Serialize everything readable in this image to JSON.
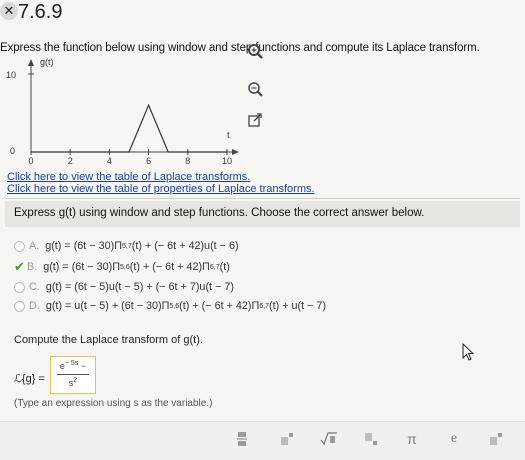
{
  "header": {
    "status_icon": "x-icon",
    "problem_number": "7.6.9"
  },
  "title": "Express the function below using window and step functions and compute its Laplace transform.",
  "graph": {
    "y_axis_label": "g(t)",
    "y_tick_label": "10",
    "x_axis_label": "t",
    "x_tick_labels": [
      "0",
      "2",
      "4",
      "6",
      "8",
      "10"
    ],
    "y_origin_label": "0"
  },
  "chart_data": {
    "type": "line",
    "x": [
      0,
      5,
      6,
      7,
      10
    ],
    "y": [
      0,
      0,
      6,
      0,
      0
    ],
    "xlim": [
      0,
      10
    ],
    "ylim": [
      0,
      10
    ],
    "xlabel": "t",
    "ylabel": "g(t)"
  },
  "links": {
    "laplace_table": "Click here to view the table of Laplace transforms.",
    "properties_table": "Click here to view the table of properties of Laplace transforms."
  },
  "question": "Express g(t) using window and step functions. Choose the correct answer below.",
  "options": [
    {
      "letter": "A.",
      "text": "g(t) = (6t − 30)Π",
      "sub": "5,7",
      "tail": "(t) + (− 6t + 42)u(t − 6)",
      "sub2": "",
      "tail2": "",
      "selected": false
    },
    {
      "letter": "B.",
      "text": "g(t) = (6t − 30)Π",
      "sub": "5,6",
      "tail": "(t) + (− 6t + 42)Π",
      "sub2": "6,7",
      "tail2": "(t)",
      "selected": true
    },
    {
      "letter": "C.",
      "text": "g(t) = (6t − 5)u(t − 5) + (− 6t + 7)u(t − 7)",
      "sub": "",
      "tail": "",
      "sub2": "",
      "tail2": "",
      "selected": false
    },
    {
      "letter": "D.",
      "text": "g(t) = u(t − 5) + (6t − 30)Π",
      "sub": "5,6",
      "tail": "(t) + (− 6t + 42)Π",
      "sub2": "6,7",
      "tail2": "(t) + u(t − 7)",
      "selected": false
    }
  ],
  "compute": "Compute the Laplace transform of g(t).",
  "laplace_label": "ℒ{g} =",
  "answer": {
    "numerator": "e",
    "numerator_exp": "− 5s",
    "numerator_tail": "−",
    "denominator": "s",
    "denominator_exp": "2"
  },
  "hint": "(Type an expression using s as the variable.)",
  "toolbar": [
    "fraction-icon",
    "superscript-icon",
    "sqrt-icon",
    "subscript-icon",
    "pi-icon",
    "e-icon",
    "exponent-icon"
  ],
  "toolbar_glyphs": {
    "pi": "π",
    "e": "e"
  }
}
